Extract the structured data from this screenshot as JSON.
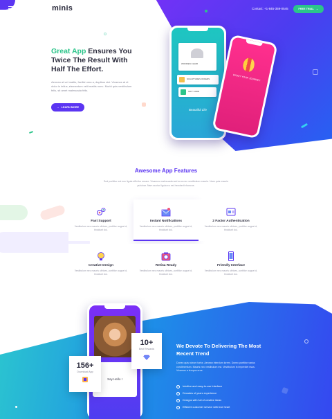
{
  "header": {
    "logo": "minis",
    "contact": "Contact: +1-845-359-0545",
    "cta_label": "FREE TRIAL",
    "cta_arrow": "→"
  },
  "hero": {
    "title_accent": "Great App",
    "title_rest": " Ensures You Twice The Result With Half The Effort.",
    "description": "Aenean at vel mattis, facilisi urna a, dapibus nisi. Vivamus at et dolor in tellus, elementum velit mattis nunc. Morbi quis vestibulum felis, sit amet malesuada felis.",
    "button_label": "LEARN MORE",
    "button_arrow": "→",
    "phone_label": "Beautiful Life",
    "phone2_text": "ENJOY YOUR JOURNEY",
    "screen_item1": "WOODEN CHAIR",
    "screen_item2": "SCULPTURES OFFERS",
    "screen_item3": "GIFT CARD"
  },
  "features": {
    "title": "Awesome App Features",
    "subtitle": "Sed porttitor est nec ligula efficitur ornare. Vivamus malesuada sed eros nec vestibulum mauris. Nam quis mauris pulvinar. Nam auctor ligula eu est hendrerit rhoncus.",
    "items": [
      {
        "name": "Fast Support",
        "desc": "Vestibulum nec mauris ultrices, porttitor augue id, tincidunt dui."
      },
      {
        "name": "Instant Notifications",
        "desc": "Vestibulum nec mauris ultrices, porttitor augue id, tincidunt dui."
      },
      {
        "name": "2 Factor Authentication",
        "desc": "Vestibulum nec mauris ultrices, porttitor augue id, tincidunt dui."
      },
      {
        "name": "Creative Design",
        "desc": "Vestibulum nec mauris ultrices, porttitor augue id, tincidunt dui."
      },
      {
        "name": "Retina Ready",
        "desc": "Vestibulum nec mauris ultrices, porttitor augue id, tincidunt dui."
      },
      {
        "name": "Friendly Interface",
        "desc": "Vestibulum nec mauris ultrices, porttitor augue id, tincidunt dui."
      }
    ]
  },
  "devote": {
    "title": "We Devote To Delivering The Most Recent Trend",
    "description": "Donec quis rutrum tortor. Aenean interdum lorem. Donec porttitor varius condimentum. Mauris nec vestibulum est. Vestibulum in imperdiet risus. Vivamus a tempus eros.",
    "checklist": [
      "Intuitive and easy-to-use Interface",
      "Decades of years experience",
      "Designs with full of creative ideas",
      "Efficient customer service with true heart"
    ],
    "stat_downloads_value": "156+",
    "stat_downloads_label": "Download App",
    "stat_awards_value": "10+",
    "stat_awards_label": "Best Rewards",
    "phone_greeting": "Say Hello !"
  },
  "colors": {
    "brand_purple": "#5b35f2",
    "brand_green": "#2bc48a",
    "gradient_blue": "#1e8de8"
  }
}
